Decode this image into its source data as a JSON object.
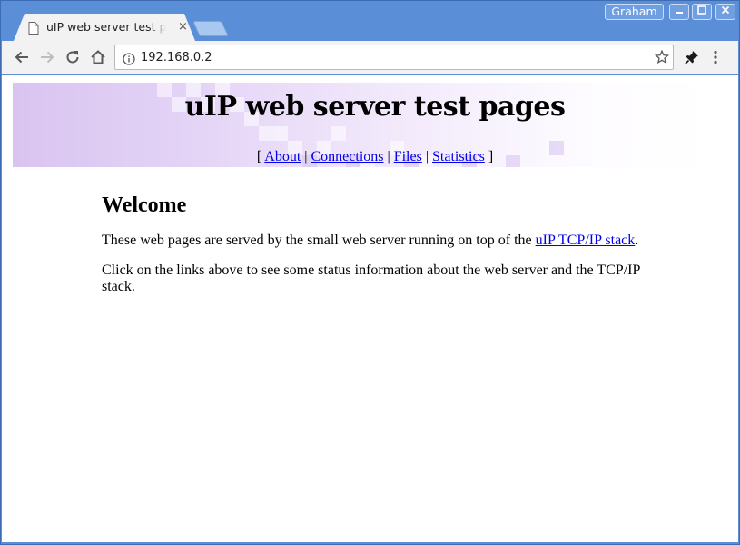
{
  "browser": {
    "tab_title": "uIP web server test pages",
    "tab_close": "×",
    "user_name": "Graham",
    "url": "192.168.0.2",
    "window_controls": [
      "minimize",
      "maximize",
      "close"
    ]
  },
  "page": {
    "site_title": "uIP web server test pages",
    "nav": {
      "open_bracket": "[",
      "close_bracket": "]",
      "separator": "|",
      "links": [
        "About",
        "Connections",
        "Files",
        "Statistics"
      ]
    },
    "heading": "Welcome",
    "para1_before": "These web pages are served by the small web server running on top of the ",
    "para1_link": "uIP TCP/IP stack",
    "para1_after": ".",
    "para2": "Click on the links above to see some status information about the web server and the TCP/IP stack."
  },
  "colors": {
    "titlebar": "#5a8fd8",
    "banner_start": "#d9c4f0",
    "link": "#0000ee"
  }
}
